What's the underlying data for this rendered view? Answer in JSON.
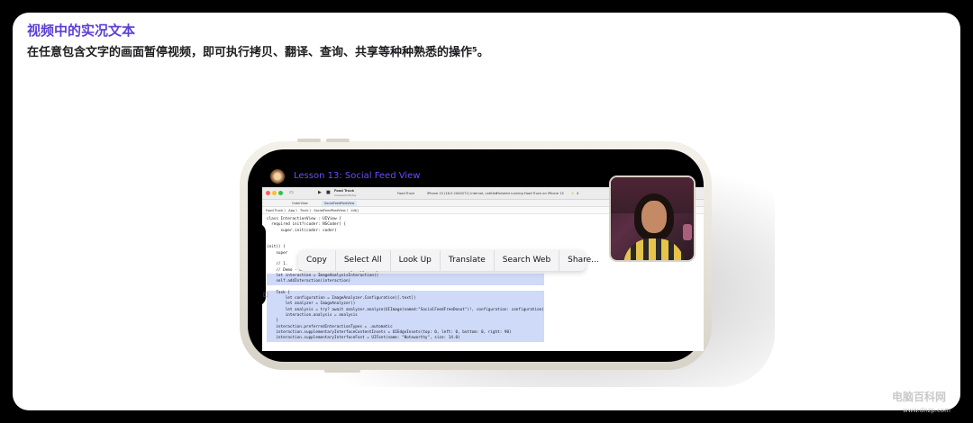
{
  "page": {
    "title": "视频中的实况文本",
    "subtitle": "在任意包含文字的画面暂停视频，即可执行拷贝、翻译、查询、共享等种种熟悉的操作⁵。"
  },
  "lesson": {
    "title": "Lesson 13: Social Feed View"
  },
  "xcode": {
    "project_name": "Food Truck",
    "project_sub": "release/birthday",
    "target_label": "Food Truck",
    "device_label": "iPhone 13 (16.0 20A5271) Internal, untitled",
    "status_text": "Finished running Food Truck on iPhone 13",
    "warning_count": "4",
    "tabs": [
      "OrderView",
      "SocialFeedPostView"
    ],
    "jump_bar": "Food Truck 〉 App 〉 Truck 〉 SocialFeedPostView 〉 init()",
    "code_lines": [
      {
        "text": "class InteractionView : UIView {",
        "hl": false
      },
      {
        "text": "  required init?(coder: NSCoder) {",
        "hl": false
      },
      {
        "text": "      super.init(coder: coder)",
        "hl": false
      },
      {
        "text": "",
        "hl": false
      },
      {
        "text": "",
        "hl": false
      },
      {
        "text": "init() {",
        "hl": false
      },
      {
        "text": "    super",
        "hl": false
      },
      {
        "text": "",
        "hl": false
      },
      {
        "text": "    // 1.",
        "hl": false
      },
      {
        "text": "    // Demo - use live text to easily copy and paste this code!",
        "hl": false
      },
      {
        "text": "    let interaction = ImageAnalysisInteraction()",
        "hl": true
      },
      {
        "text": "    self.addInteraction(interaction)",
        "hl": true
      },
      {
        "text": "",
        "hl": false
      },
      {
        "text": "    Task {",
        "hl": true
      },
      {
        "text": "        let configuration = ImageAnalyzer.Configuration([.text])",
        "hl": true
      },
      {
        "text": "        let analyzer = ImageAnalyzer()",
        "hl": true
      },
      {
        "text": "        let analysis = try? await analyzer.analyze(UIImage(named:\"SocialFeedFreeDonut\")!, configuration: configuration)",
        "hl": true
      },
      {
        "text": "        interaction.analysis = analysis",
        "hl": true
      },
      {
        "text": "    }",
        "hl": true
      },
      {
        "text": "    interaction.preferredInteractionTypes = .automatic",
        "hl": true
      },
      {
        "text": "    interaction.supplementaryInterfaceContentInsets = UIEdgeInsets(top: 0, left: 0, bottom: 0, right: 90)",
        "hl": true
      },
      {
        "text": "    interaction.supplementaryInterfaceFont = UIFont(name: \"Noteworthy\", size: 14.0)",
        "hl": true
      },
      {
        "text": "",
        "hl": false
      },
      {
        "text": "",
        "hl": false
      },
      {
        "text": "  }",
        "hl": false
      }
    ]
  },
  "context_menu": {
    "items": [
      "Copy",
      "Select All",
      "Look Up",
      "Translate",
      "Search Web",
      "Share..."
    ]
  },
  "watermark": {
    "main": "电脑百科网",
    "sub": "www.dnzp.com"
  },
  "colors": {
    "title": "#5b3fd6",
    "lesson": "#6a4cff",
    "highlight": "#cfd9f8"
  }
}
